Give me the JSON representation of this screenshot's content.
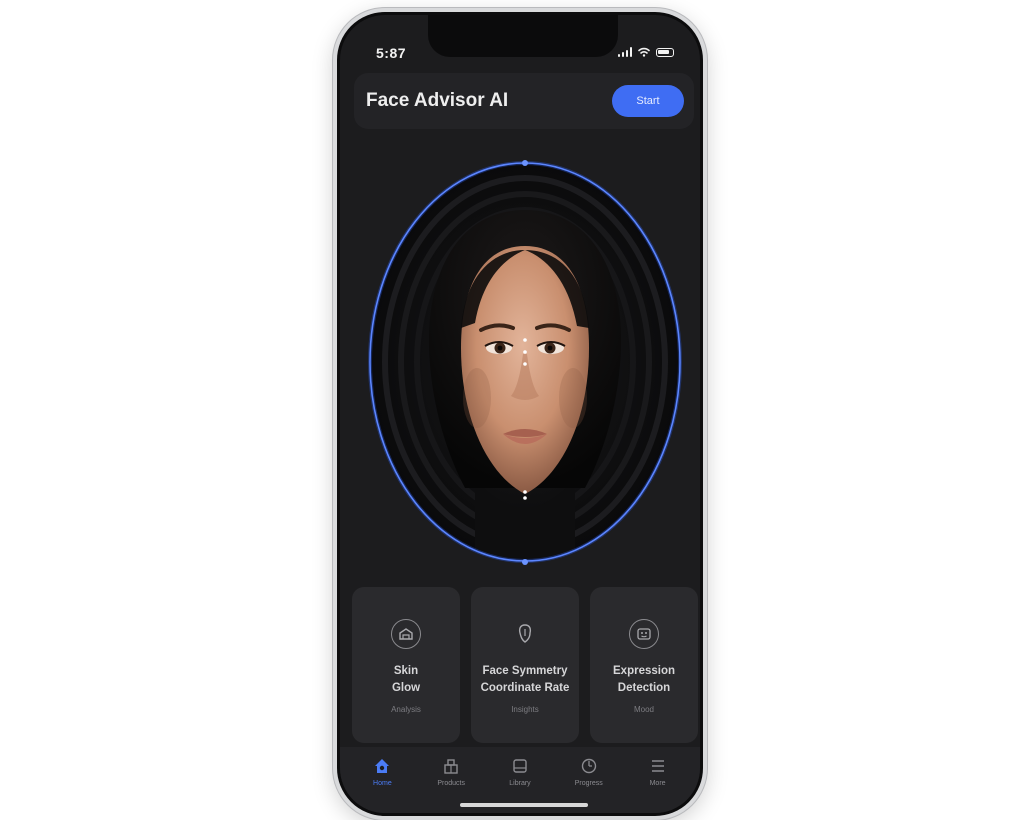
{
  "status_bar": {
    "time": "5:87"
  },
  "header": {
    "title": "Face Advisor AI",
    "action_label": "Start"
  },
  "scanner": {
    "image_alt": "face scan"
  },
  "cards": [
    {
      "title": "Skin\nGlow",
      "subtitle": "Analysis"
    },
    {
      "title": "Face Symmetry\nCoordinate Rate",
      "subtitle": "Insights"
    },
    {
      "title": "Expression\nDetection",
      "subtitle": "Mood"
    }
  ],
  "tabs": [
    {
      "label": "Home",
      "icon": "home-icon",
      "active": true
    },
    {
      "label": "Products",
      "icon": "products-icon",
      "active": false
    },
    {
      "label": "Library",
      "icon": "library-icon",
      "active": false
    },
    {
      "label": "Progress",
      "icon": "progress-icon",
      "active": false
    },
    {
      "label": "More",
      "icon": "menu-icon",
      "active": false
    }
  ],
  "colors": {
    "accent": "#3f6df3",
    "background": "#1c1c1e",
    "card": "#2a2a2d"
  }
}
